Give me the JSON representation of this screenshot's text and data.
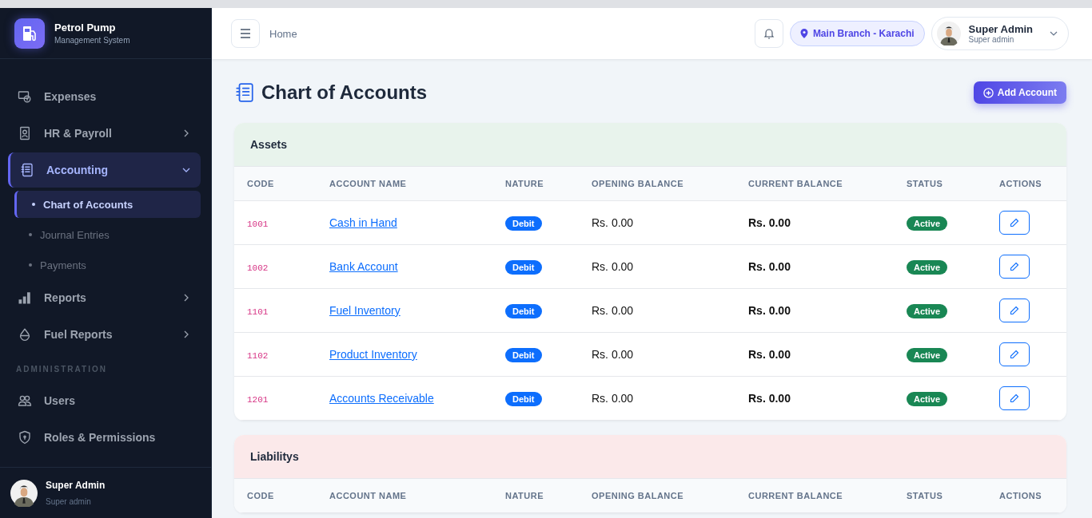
{
  "brand": {
    "title": "Petrol Pump",
    "subtitle": "Management System"
  },
  "sidebar": {
    "sections": [
      {
        "items": [
          {
            "label": "Expenses",
            "selected": false
          },
          {
            "label": "HR & Payroll",
            "selected": false,
            "expanded": false
          },
          {
            "label": "Accounting",
            "selected": true,
            "expanded": true,
            "children": [
              {
                "label": "Chart of Accounts",
                "selected": true
              },
              {
                "label": "Journal Entries",
                "selected": false
              },
              {
                "label": "Payments",
                "selected": false
              }
            ]
          },
          {
            "label": "Reports",
            "selected": false,
            "expanded": false
          },
          {
            "label": "Fuel Reports",
            "selected": false,
            "expanded": false
          }
        ]
      },
      {
        "heading": "ADMINISTRATION",
        "items": [
          {
            "label": "Users",
            "selected": false
          },
          {
            "label": "Roles & Permissions",
            "selected": false
          }
        ]
      }
    ],
    "user": {
      "name": "Super Admin",
      "role": "Super admin"
    }
  },
  "header": {
    "breadcrumb": "Home",
    "branch": "Main Branch - Karachi",
    "user": {
      "name": "Super Admin",
      "role": "Super admin"
    }
  },
  "page": {
    "title": "Chart of Accounts",
    "add_button": "Add Account"
  },
  "groups": [
    {
      "title": "Assets",
      "color": "#e8f3ec",
      "columns": [
        "CODE",
        "ACCOUNT NAME",
        "NATURE",
        "OPENING BALANCE",
        "CURRENT BALANCE",
        "STATUS",
        "ACTIONS"
      ],
      "rows": [
        {
          "code": "1001",
          "name": "Cash in Hand",
          "nature": "Debit",
          "opening": "Rs. 0.00",
          "current": "Rs. 0.00",
          "status": "Active"
        },
        {
          "code": "1002",
          "name": "Bank Account",
          "nature": "Debit",
          "opening": "Rs. 0.00",
          "current": "Rs. 0.00",
          "status": "Active"
        },
        {
          "code": "1101",
          "name": "Fuel Inventory",
          "nature": "Debit",
          "opening": "Rs. 0.00",
          "current": "Rs. 0.00",
          "status": "Active"
        },
        {
          "code": "1102",
          "name": "Product Inventory",
          "nature": "Debit",
          "opening": "Rs. 0.00",
          "current": "Rs. 0.00",
          "status": "Active"
        },
        {
          "code": "1201",
          "name": "Accounts Receivable",
          "nature": "Debit",
          "opening": "Rs. 0.00",
          "current": "Rs. 0.00",
          "status": "Active"
        }
      ]
    },
    {
      "title": "Liabilitys",
      "color": "#fbe9ea",
      "columns": [
        "CODE",
        "ACCOUNT NAME",
        "NATURE",
        "OPENING BALANCE",
        "CURRENT BALANCE",
        "STATUS",
        "ACTIONS"
      ]
    }
  ]
}
